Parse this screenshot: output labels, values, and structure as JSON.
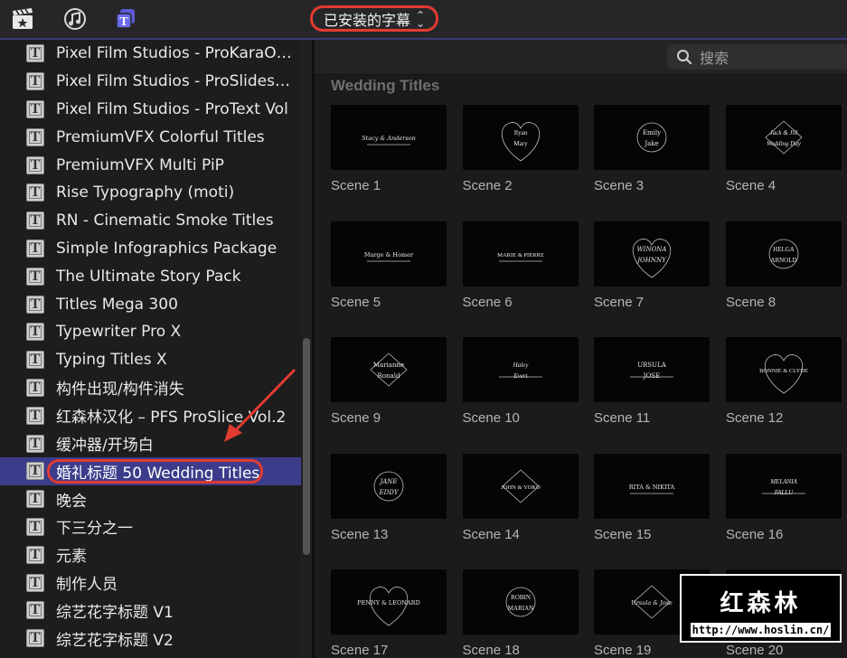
{
  "toolbar": {
    "icons": [
      "clapper-star-icon",
      "music-note-icon",
      "titles-icon"
    ],
    "dropdown_label": "已安装的字幕"
  },
  "sidebar": {
    "items": [
      {
        "label": "Pixel Film Studios - ProKaraOKE"
      },
      {
        "label": "Pixel Film Studios - ProSlideshow"
      },
      {
        "label": "Pixel Film Studios - ProText Vol"
      },
      {
        "label": "PremiumVFX Colorful Titles"
      },
      {
        "label": "PremiumVFX Multi PiP"
      },
      {
        "label": "Rise Typography (moti)"
      },
      {
        "label": "RN - Cinematic Smoke Titles"
      },
      {
        "label": "Simple Infographics Package"
      },
      {
        "label": "The Ultimate Story Pack"
      },
      {
        "label": "Titles Mega 300"
      },
      {
        "label": "Typewriter Pro X"
      },
      {
        "label": "Typing Titles X"
      },
      {
        "label": "构件出现/构件消失"
      },
      {
        "label": "红森林汉化 – PFS ProSlice Vol.2"
      },
      {
        "label": "缓冲器/开场白"
      },
      {
        "label": "婚礼标题 50 Wedding Titles",
        "selected": true
      },
      {
        "label": "晚会"
      },
      {
        "label": "下三分之一"
      },
      {
        "label": "元素"
      },
      {
        "label": "制作人员"
      },
      {
        "label": "综艺花字标题 V1"
      },
      {
        "label": "综艺花字标题 V2"
      }
    ]
  },
  "search": {
    "placeholder": "搜索"
  },
  "browser": {
    "section_title": "Wedding Titles",
    "scenes": [
      {
        "caption": "Scene 1",
        "t1": "Stacy & Anderson",
        "t2": ""
      },
      {
        "caption": "Scene 2",
        "t1": "Ryan",
        "t2": "Mary"
      },
      {
        "caption": "Scene 3",
        "t1": "Emily",
        "t2": "Jake"
      },
      {
        "caption": "Scene 4",
        "t1": "Jack & Jill",
        "t2": "Wedding Day"
      },
      {
        "caption": "Scene 5",
        "t1": "Marge & Homer",
        "t2": ""
      },
      {
        "caption": "Scene 6",
        "t1": "MARIE & PIERRE",
        "t2": ""
      },
      {
        "caption": "Scene 7",
        "t1": "WINONA",
        "t2": "JOHNNY"
      },
      {
        "caption": "Scene 8",
        "t1": "HELGA",
        "t2": "ARNOLD"
      },
      {
        "caption": "Scene 9",
        "t1": "Marianne",
        "t2": "Ronald"
      },
      {
        "caption": "Scene 10",
        "t1": "Haley",
        "t2": "Evert"
      },
      {
        "caption": "Scene 11",
        "t1": "URSULA",
        "t2": "JOSE"
      },
      {
        "caption": "Scene 12",
        "t1": "BONNIE & CLYDE",
        "t2": ""
      },
      {
        "caption": "Scene 13",
        "t1": "JANE",
        "t2": "EDDY"
      },
      {
        "caption": "Scene 14",
        "t1": "JOHN & YOKO",
        "t2": ""
      },
      {
        "caption": "Scene 15",
        "t1": "RITA & NIKITA",
        "t2": ""
      },
      {
        "caption": "Scene 16",
        "t1": "MELANIA",
        "t2": "FALLU"
      },
      {
        "caption": "Scene 17",
        "t1": "PENNY & LEONARD",
        "t2": ""
      },
      {
        "caption": "Scene 18",
        "t1": "ROBIN",
        "t2": "MARIAN"
      },
      {
        "caption": "Scene 19",
        "t1": "Ursula & Jose",
        "t2": ""
      },
      {
        "caption": "Scene 20",
        "t1": "",
        "t2": ""
      }
    ]
  },
  "watermark": {
    "title": "红森林",
    "url": "http://www.hoslin.cn/"
  },
  "colors": {
    "selection": "#3c3d8a",
    "annotation": "#e23b30",
    "background": "#1e1e1f"
  }
}
